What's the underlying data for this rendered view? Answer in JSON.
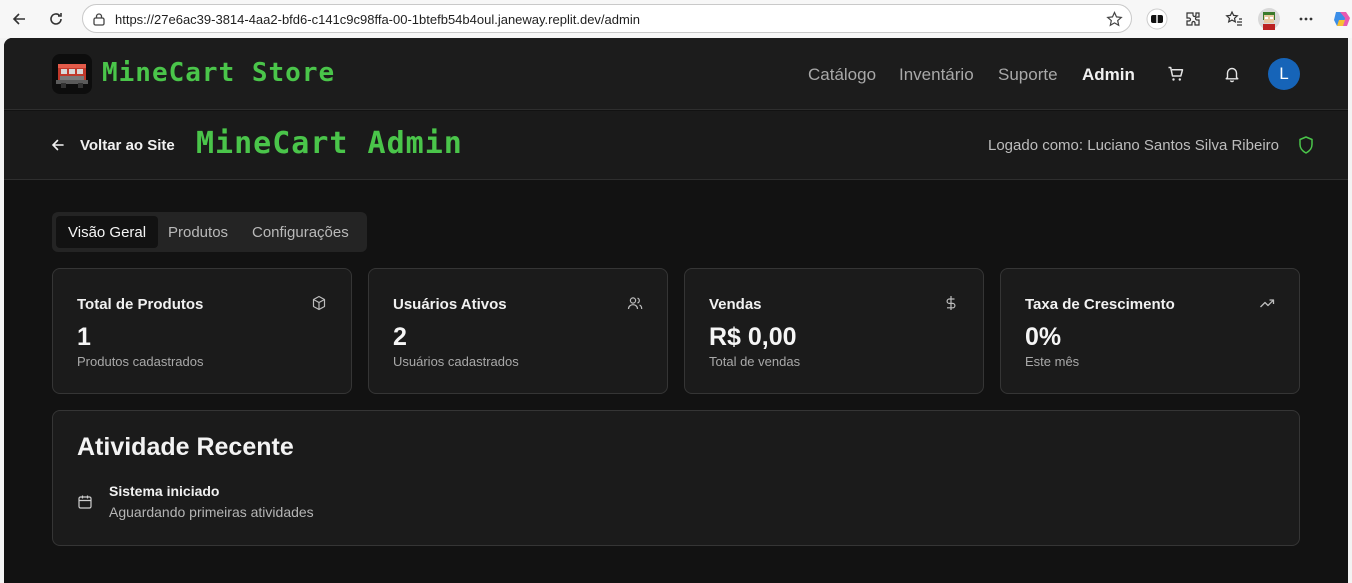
{
  "browser": {
    "url": "https://27e6ac39-3814-4aa2-bfd6-c141c9c98ffa-00-1btefb54b4oul.janeway.replit.dev/admin"
  },
  "header": {
    "brand": "MineCart Store",
    "nav": [
      "Catálogo",
      "Inventário",
      "Suporte",
      "Admin"
    ],
    "avatar_initial": "L"
  },
  "admin": {
    "back_label": "Voltar ao Site",
    "title": "MineCart Admin",
    "logged_in": "Logado como: Luciano Santos Silva Ribeiro"
  },
  "tabs": [
    "Visão Geral",
    "Produtos",
    "Configurações"
  ],
  "stats": [
    {
      "title": "Total de Produtos",
      "value": "1",
      "sub": "Produtos cadastrados",
      "icon": "package-icon"
    },
    {
      "title": "Usuários Ativos",
      "value": "2",
      "sub": "Usuários cadastrados",
      "icon": "users-icon"
    },
    {
      "title": "Vendas",
      "value": "R$ 0,00",
      "sub": "Total de vendas",
      "icon": "dollar-icon"
    },
    {
      "title": "Taxa de Crescimento",
      "value": "0%",
      "sub": "Este mês",
      "icon": "trending-up-icon"
    }
  ],
  "activity": {
    "title": "Atividade Recente",
    "item_title": "Sistema iniciado",
    "item_sub": "Aguardando primeiras atividades"
  },
  "colors": {
    "accent_green": "#4ac54a",
    "background": "#121212",
    "avatar_blue": "#1664b8"
  }
}
